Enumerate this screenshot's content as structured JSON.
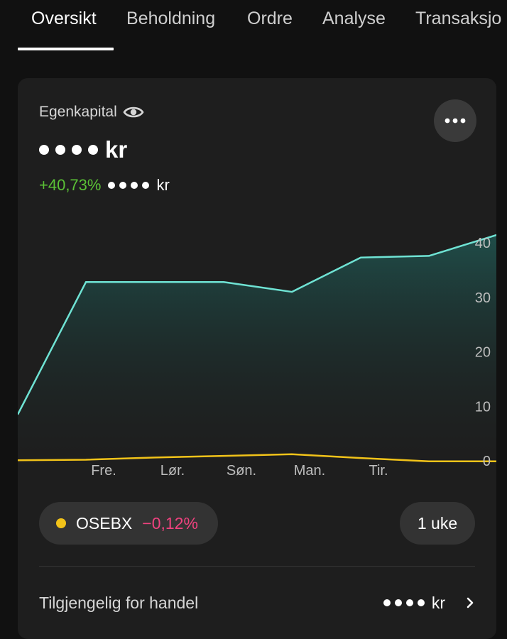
{
  "tabs": [
    {
      "label": "Oversikt",
      "active": true
    },
    {
      "label": "Beholdning",
      "active": false
    },
    {
      "label": "Ordre",
      "active": false
    },
    {
      "label": "Analyse",
      "active": false
    },
    {
      "label": "Transaksjo",
      "active": false
    }
  ],
  "card": {
    "label": "Egenkapital",
    "label_icon": "eye-icon",
    "more_icon": "more-dots-icon",
    "equity_currency": "kr",
    "change_percent": "+40,73%",
    "change_currency": "kr",
    "colors": {
      "positive": "#5bc236",
      "negative": "#f0427f",
      "portfolio_line": "#6fe3d4",
      "benchmark_line": "#f2c319"
    }
  },
  "chart_data": {
    "type": "area",
    "x": [
      "",
      "Fre.",
      "Lør.",
      "Søn.",
      "Man.",
      "Tir.",
      "",
      ""
    ],
    "x_tick_labels": [
      "Fre.",
      "Lør.",
      "Søn.",
      "Man.",
      "Tir."
    ],
    "y_ticks": [
      "40",
      "30",
      "20",
      "10",
      "0"
    ],
    "ylim": [
      0,
      44
    ],
    "y_axis_side": "right",
    "grid": false,
    "series": [
      {
        "values": [
          8.5,
          32.8,
          32.8,
          32.8,
          31.0,
          37.3,
          37.6,
          41.5
        ],
        "color": "#6fe3d4"
      },
      {
        "values": [
          0.1,
          0.2,
          0.6,
          0.9,
          1.2,
          0.5,
          -0.1,
          -0.1
        ],
        "color": "#f2c319"
      }
    ]
  },
  "benchmark": {
    "name": "OSEBX",
    "change": "−0,12%",
    "dot_color": "#f2c319"
  },
  "period": {
    "label": "1 uke"
  },
  "available": {
    "label": "Tilgjengelig for handel",
    "currency": "kr",
    "chevron_icon": "chevron-right-icon"
  }
}
